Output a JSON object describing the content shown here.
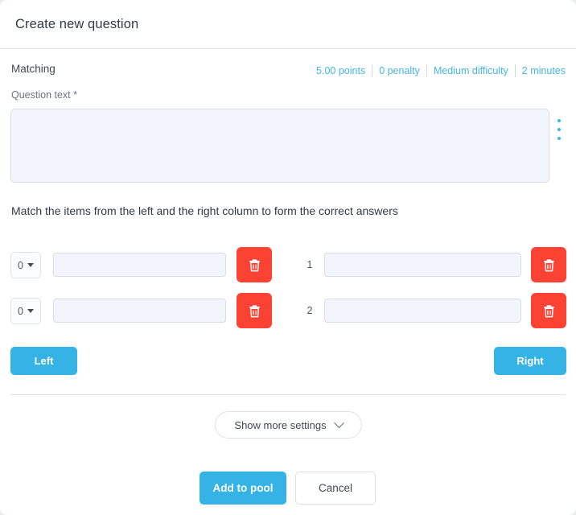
{
  "dialog": {
    "title": "Create new question",
    "question_type": "Matching",
    "meta": [
      {
        "label": "5.00 points"
      },
      {
        "label": "0 penalty"
      },
      {
        "label": "Medium difficulty"
      },
      {
        "label": "2 minutes"
      }
    ],
    "question_text": {
      "label": "Question text *",
      "value": "",
      "placeholder": ""
    },
    "kebab_icon": "more-vertical-icon",
    "instruction": "Match the items from the left and the right column to form the correct answers",
    "match_rows": [
      {
        "order_value": "0",
        "left_value": "",
        "left_placeholder": "",
        "right_index": "1",
        "right_value": "",
        "right_placeholder": "",
        "delete_icon": "trash-icon"
      },
      {
        "order_value": "0",
        "left_value": "",
        "left_placeholder": "",
        "right_index": "2",
        "right_value": "",
        "right_placeholder": "",
        "delete_icon": "trash-icon"
      }
    ],
    "column_buttons": {
      "left": "Left",
      "right": "Right"
    },
    "show_more": {
      "label": "Show more settings",
      "icon": "chevron-down-icon"
    },
    "footer": {
      "submit": "Add to pool",
      "cancel": "Cancel"
    },
    "colors": {
      "accent_blue": "#34b3e4",
      "danger_red": "#fc4233",
      "input_fill": "#f2f5fb",
      "border": "#dfe3e8",
      "text": "#3e4a52"
    }
  }
}
